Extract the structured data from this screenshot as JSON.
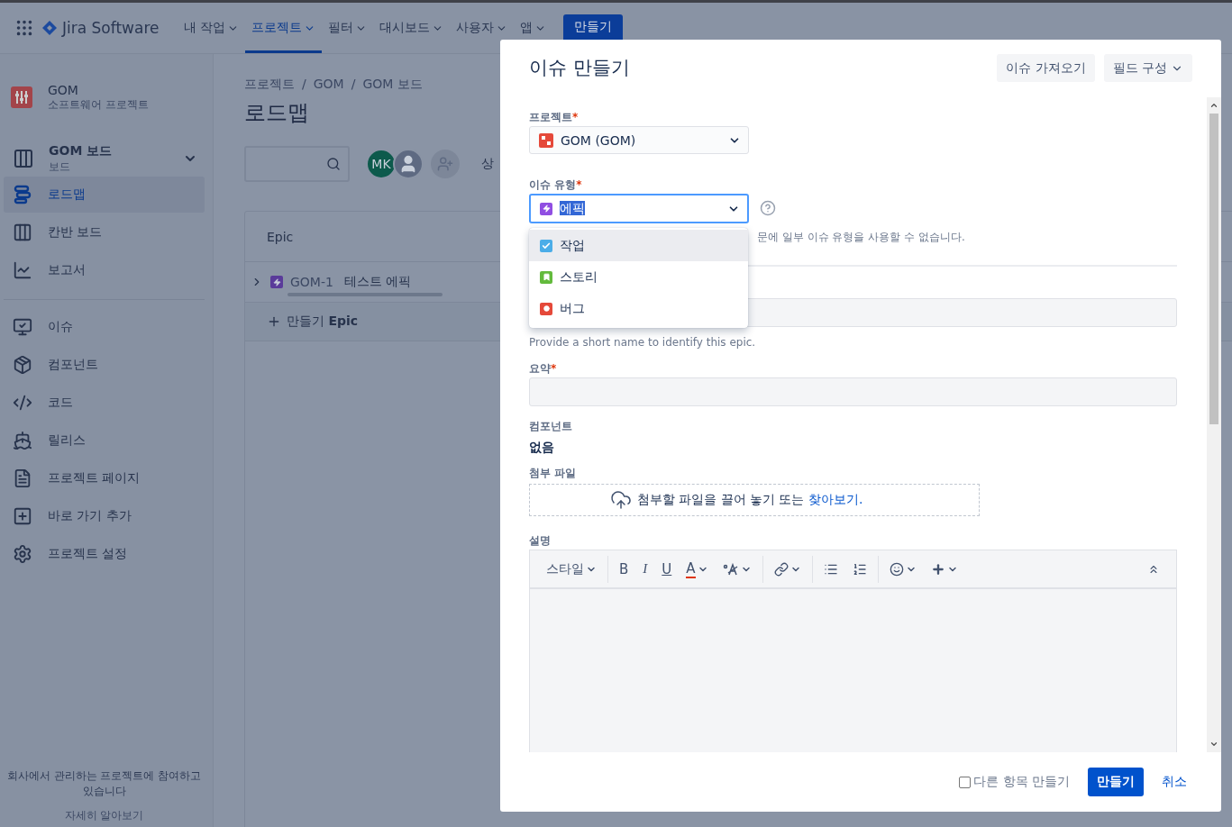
{
  "top_nav": {
    "product": "Jira Software",
    "menus": [
      {
        "label": "내 작업",
        "selected": false
      },
      {
        "label": "프로젝트",
        "selected": true
      },
      {
        "label": "필터",
        "selected": false
      },
      {
        "label": "대시보드",
        "selected": false
      },
      {
        "label": "사용자",
        "selected": false
      },
      {
        "label": "앱",
        "selected": false
      }
    ],
    "create_button": "만들기"
  },
  "sidebar": {
    "project": {
      "name": "GOM",
      "type": "소프트웨어 프로젝트"
    },
    "board": {
      "name": "GOM 보드",
      "type": "보드"
    },
    "groups": [
      [
        {
          "label": "로드맵",
          "selected": true
        },
        {
          "label": "칸반 보드",
          "selected": false
        },
        {
          "label": "보고서",
          "selected": false
        }
      ],
      [
        {
          "label": "이슈",
          "selected": false
        },
        {
          "label": "컴포넌트",
          "selected": false
        },
        {
          "label": "코드",
          "selected": false
        },
        {
          "label": "릴리스",
          "selected": false
        },
        {
          "label": "프로젝트 페이지",
          "selected": false
        },
        {
          "label": "바로 가기 추가",
          "selected": false
        },
        {
          "label": "프로젝트 설정",
          "selected": false
        }
      ]
    ],
    "note": "회사에서 관리하는 프로젝트에 참여하고 있습니다",
    "note_link": "자세히 알아보기"
  },
  "main": {
    "breadcrumbs": [
      "프로젝트",
      "GOM",
      "GOM 보드"
    ],
    "separator": "/",
    "title": "로드맵",
    "avatars": [
      {
        "kind": "initials",
        "initials": "MK"
      },
      {
        "kind": "silhouette"
      }
    ],
    "cut_label": "상",
    "table": {
      "header": "Epic",
      "rows": [
        {
          "key": "GOM-1",
          "summary": "테스트 에픽",
          "expanded": false,
          "progress": {
            "level": 0
          }
        }
      ],
      "create_row": "만들기 **Epic**"
    }
  },
  "modal": {
    "title": "이슈 만들기",
    "header_buttons": [
      {
        "label": "이슈 가져오기",
        "kind": "plain"
      },
      {
        "label": "필드 구성",
        "kind": "menu"
      }
    ],
    "required_mark": "*",
    "project": {
      "label": "프로젝트",
      "required": true,
      "value": "GOM (GOM)"
    },
    "issue_type": {
      "label": "이슈 유형",
      "required": true,
      "value": "에픽",
      "focused": true,
      "value_highlighted": true,
      "note": "문에 일부 이슈 유형을 사용할 수 없습니다.",
      "options": [
        {
          "label": "작업",
          "kind": "task",
          "color": "#4bade8",
          "highlighted": true
        },
        {
          "label": "스토리",
          "kind": "story",
          "color": "#63ba3c",
          "highlighted": false
        },
        {
          "label": "버그",
          "kind": "bug",
          "color": "#e5493a",
          "highlighted": false
        }
      ]
    },
    "epic_name": {
      "hint": "Provide a short name to identify this epic."
    },
    "summary": {
      "label": "요약",
      "required": true
    },
    "components": {
      "label": "컴포넌트",
      "value": "없음"
    },
    "attachment": {
      "label": "첨부 파일",
      "text": "첨부할 파일을 끌어 놓기 또는",
      "link": "찾아보기."
    },
    "description": {
      "label": "설명",
      "style_menu": "스타일",
      "format_letters": [
        {
          "kind": "bold",
          "label": "B"
        },
        {
          "kind": "italic",
          "label": "I"
        },
        {
          "kind": "underline",
          "label": "U"
        },
        {
          "kind": "color",
          "label": "A"
        }
      ]
    },
    "footer": {
      "create_another": {
        "label": "다른 항목 만들기",
        "checked": false
      },
      "submit": "만들기",
      "cancel": "취소"
    }
  }
}
